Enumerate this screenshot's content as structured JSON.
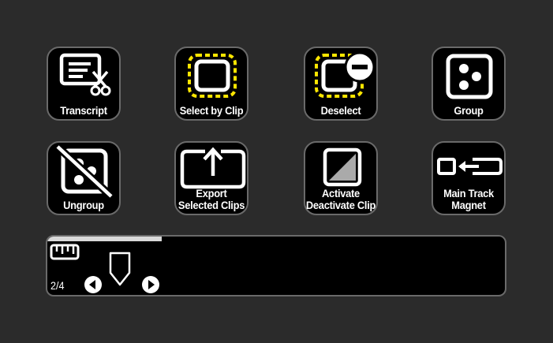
{
  "colors": {
    "background": "#2b2b2b",
    "tile": "#000000",
    "border": "#6a6a6a",
    "highlight": "#ffe600",
    "icon": "#ffffff"
  },
  "tiles": [
    {
      "id": "transcript",
      "icon": "transcript-scissors-icon",
      "lines": [
        "Transcript"
      ]
    },
    {
      "id": "select-by-clip",
      "icon": "select-by-clip-icon",
      "lines": [
        "Select by Clip"
      ]
    },
    {
      "id": "deselect",
      "icon": "deselect-icon",
      "lines": [
        "Deselect"
      ]
    },
    {
      "id": "group",
      "icon": "group-icon",
      "lines": [
        "Group"
      ]
    },
    {
      "id": "ungroup",
      "icon": "ungroup-icon",
      "lines": [
        "Ungroup"
      ]
    },
    {
      "id": "export-selected-clips",
      "icon": "export-icon",
      "lines": [
        "Export",
        "Selected Clips"
      ]
    },
    {
      "id": "activate-deactivate-clip",
      "icon": "activate-deactivate-icon",
      "lines": [
        "Activate",
        "Deactivate Clip"
      ]
    },
    {
      "id": "main-track-magnet",
      "icon": "magnet-track-icon",
      "lines": [
        "Main Track",
        "Magnet"
      ]
    }
  ],
  "pager": {
    "page_indicator": "2/4",
    "progress": 0.25,
    "icons": [
      "ruler-icon",
      "playhead-marker-icon",
      "prev-arrow-icon",
      "next-arrow-icon"
    ]
  }
}
